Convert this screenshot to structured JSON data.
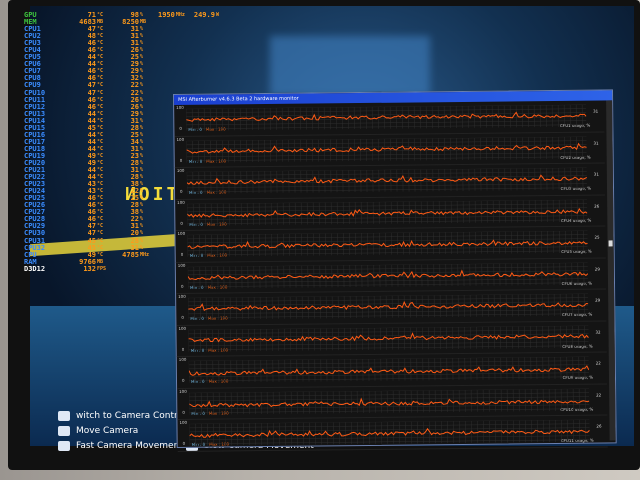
{
  "osd": {
    "gpu": {
      "label": "GPU",
      "temp": "71",
      "temp_unit": "°C",
      "load": "98",
      "load_unit": "%",
      "clock": "1950",
      "clock_unit": "MHz",
      "power": "249.9",
      "power_unit": "W"
    },
    "mem": {
      "label": "MEM",
      "used": "4683",
      "used_unit": "MB",
      "total": "8250",
      "total_unit": "MB"
    },
    "cpus": [
      {
        "label": "CPU1",
        "temp": "47",
        "load": "31"
      },
      {
        "label": "CPU2",
        "temp": "48",
        "load": "31"
      },
      {
        "label": "CPU3",
        "temp": "46",
        "load": "31"
      },
      {
        "label": "CPU4",
        "temp": "46",
        "load": "26"
      },
      {
        "label": "CPU5",
        "temp": "44",
        "load": "25"
      },
      {
        "label": "CPU6",
        "temp": "44",
        "load": "29"
      },
      {
        "label": "CPU7",
        "temp": "46",
        "load": "29"
      },
      {
        "label": "CPU8",
        "temp": "46",
        "load": "32"
      },
      {
        "label": "CPU9",
        "temp": "47",
        "load": "22"
      },
      {
        "label": "CPU10",
        "temp": "47",
        "load": "22"
      },
      {
        "label": "CPU11",
        "temp": "46",
        "load": "26"
      },
      {
        "label": "CPU12",
        "temp": "46",
        "load": "26"
      },
      {
        "label": "CPU13",
        "temp": "44",
        "load": "29"
      },
      {
        "label": "CPU14",
        "temp": "44",
        "load": "31"
      },
      {
        "label": "CPU15",
        "temp": "45",
        "load": "28"
      },
      {
        "label": "CPU16",
        "temp": "44",
        "load": "25"
      },
      {
        "label": "CPU17",
        "temp": "44",
        "load": "34"
      },
      {
        "label": "CPU18",
        "temp": "44",
        "load": "31"
      },
      {
        "label": "CPU19",
        "temp": "49",
        "load": "23"
      },
      {
        "label": "CPU20",
        "temp": "49",
        "load": "28"
      },
      {
        "label": "CPU21",
        "temp": "44",
        "load": "31"
      },
      {
        "label": "CPU22",
        "temp": "44",
        "load": "28"
      },
      {
        "label": "CPU23",
        "temp": "43",
        "load": "38"
      },
      {
        "label": "CPU24",
        "temp": "43",
        "load": "22"
      },
      {
        "label": "CPU25",
        "temp": "46",
        "load": "25"
      },
      {
        "label": "CPU26",
        "temp": "46",
        "load": "28"
      },
      {
        "label": "CPU27",
        "temp": "46",
        "load": "38"
      },
      {
        "label": "CPU28",
        "temp": "46",
        "load": "22"
      },
      {
        "label": "CPU29",
        "temp": "47",
        "load": "31"
      },
      {
        "label": "CPU30",
        "temp": "47",
        "load": "20"
      },
      {
        "label": "CPU31",
        "temp": "45",
        "load": "28"
      },
      {
        "label": "CPU32",
        "temp": "45",
        "load": "31"
      }
    ],
    "temp_unit": "°C",
    "load_unit": "%",
    "cpu_total": {
      "label": "CPU",
      "temp": "49",
      "clock": "4785",
      "clock_unit": "MHz"
    },
    "ram": {
      "label": "RAM",
      "value": "9766",
      "unit": "MB"
    },
    "d3d": {
      "label": "D3D12",
      "fps": "132",
      "unit": "FPS"
    }
  },
  "game": {
    "sign_text": "CAUTION",
    "hints": [
      "witch to Camera Controls",
      "Move Camera",
      "Fast Camera Movement"
    ],
    "hint_right": "Slow Camera Movement"
  },
  "monitor_window": {
    "title": "MSI Afterburner v4.6.3 Beta 2 hardware monitor",
    "colors": {
      "line": "#ff5a14",
      "grid": "#2e2e2e",
      "titlebar": "#2050e0"
    }
  },
  "chart_data": {
    "type": "line",
    "ylim": [
      0,
      100
    ],
    "y_max_label": "100",
    "y_min_label": "0",
    "min_label": "Min : 0",
    "max_label": "Max : 100",
    "series": [
      {
        "name": "CPU1 usage, %",
        "level": 31
      },
      {
        "name": "CPU2 usage, %",
        "level": 31
      },
      {
        "name": "CPU3 usage, %",
        "level": 31
      },
      {
        "name": "CPU4 usage, %",
        "level": 26
      },
      {
        "name": "CPU5 usage, %",
        "level": 25
      },
      {
        "name": "CPU6 usage, %",
        "level": 29
      },
      {
        "name": "CPU7 usage, %",
        "level": 29
      },
      {
        "name": "CPU8 usage, %",
        "level": 32
      },
      {
        "name": "CPU9 usage, %",
        "level": 22
      },
      {
        "name": "CPU10 usage, %",
        "level": 22
      },
      {
        "name": "CPU11 usage, %",
        "level": 26
      }
    ]
  }
}
